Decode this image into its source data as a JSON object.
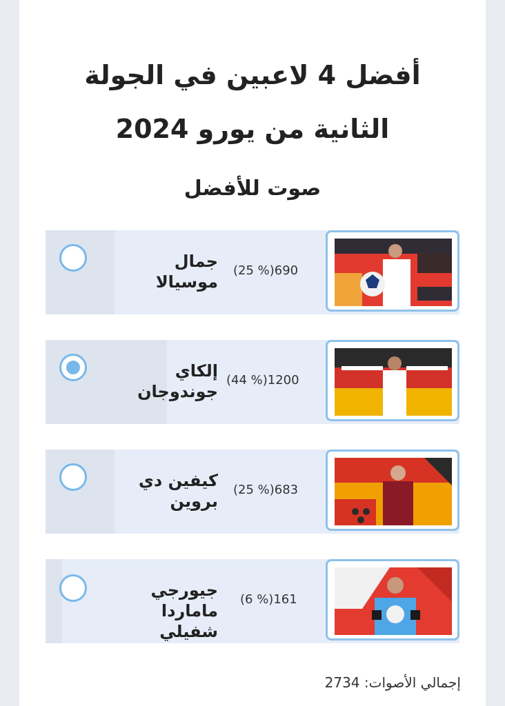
{
  "poll": {
    "title": "أفضل 4 لاعبين في الجولة الثانية من يورو 2024",
    "subtitle": "صوت للأفضل",
    "options": [
      {
        "name": "جمال موسيالا",
        "votes": "690",
        "percent": "(25 %)",
        "fraction": 0.25,
        "selected": false
      },
      {
        "name": "إلكاي جوندوجان",
        "votes": "1200",
        "percent": "(44 %)",
        "fraction": 0.44,
        "selected": true
      },
      {
        "name": "كيفين دي بروين",
        "votes": "683",
        "percent": "(25 %)",
        "fraction": 0.25,
        "selected": false
      },
      {
        "name": "جيورجي ماماردا شفيلي",
        "votes": "161",
        "percent": "(6 %)",
        "fraction": 0.06,
        "selected": false
      }
    ],
    "total_label": "إجمالي الأصوات:",
    "total_value": "2734"
  },
  "colors": {
    "accent": "#79b8ea",
    "row_bg": "#e6edf8"
  },
  "icons": {
    "radio": "radio-circle-icon"
  }
}
